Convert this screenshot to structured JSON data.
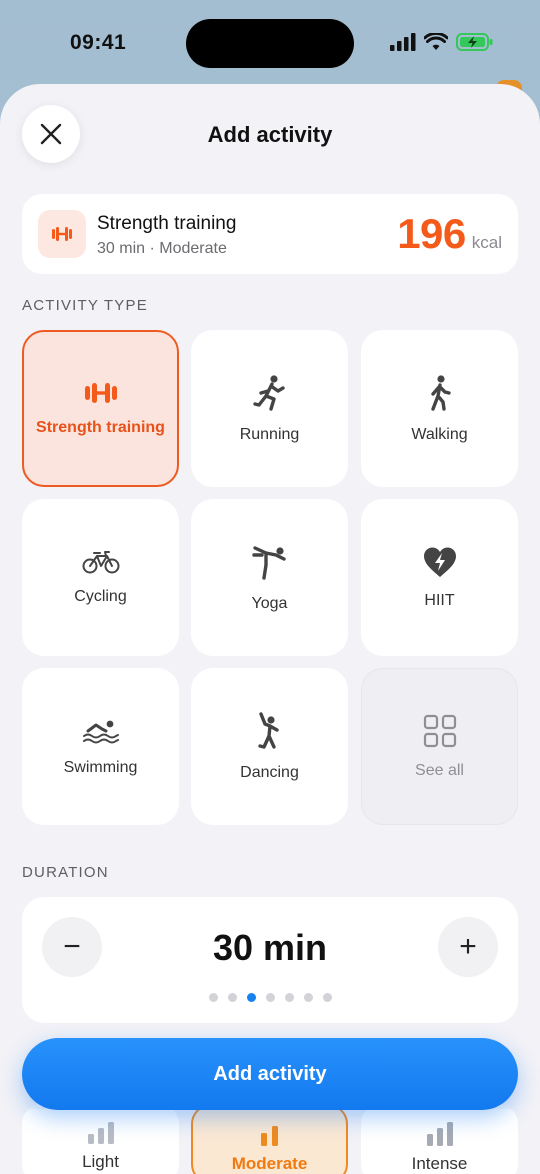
{
  "status_bar": {
    "time": "09:41"
  },
  "header": {
    "title": "Add activity",
    "close_icon": "close-icon"
  },
  "summary": {
    "icon": "dumbbell-icon",
    "name": "Strength training",
    "meta": "30 min · Moderate",
    "kcal_value": "196",
    "kcal_unit": "kcal"
  },
  "activity_section": {
    "label": "ACTIVITY TYPE",
    "items": [
      {
        "label": "Strength training",
        "icon": "dumbbell-icon",
        "selected": true
      },
      {
        "label": "Running",
        "icon": "running-icon",
        "selected": false
      },
      {
        "label": "Walking",
        "icon": "walking-icon",
        "selected": false
      },
      {
        "label": "Cycling",
        "icon": "bicycle-icon",
        "selected": false
      },
      {
        "label": "Yoga",
        "icon": "yoga-icon",
        "selected": false
      },
      {
        "label": "HIIT",
        "icon": "heart-bolt-icon",
        "selected": false
      },
      {
        "label": "Swimming",
        "icon": "swimming-icon",
        "selected": false
      },
      {
        "label": "Dancing",
        "icon": "dancing-icon",
        "selected": false
      },
      {
        "label": "See all",
        "icon": "grid-icon",
        "selected": false
      }
    ]
  },
  "duration_section": {
    "label": "DURATION",
    "value": "30 min",
    "minus_label": "−",
    "plus_label": "+",
    "dot_count": 7,
    "active_dot": 2
  },
  "intensity": {
    "items": [
      {
        "label": "Light",
        "selected": false
      },
      {
        "label": "Moderate",
        "selected": true
      },
      {
        "label": "Intense",
        "selected": false
      }
    ]
  },
  "cta": {
    "label": "Add activity"
  },
  "colors": {
    "accent": "#F45A1A",
    "primary": "#1682F2",
    "background": "#F2F2F7"
  }
}
